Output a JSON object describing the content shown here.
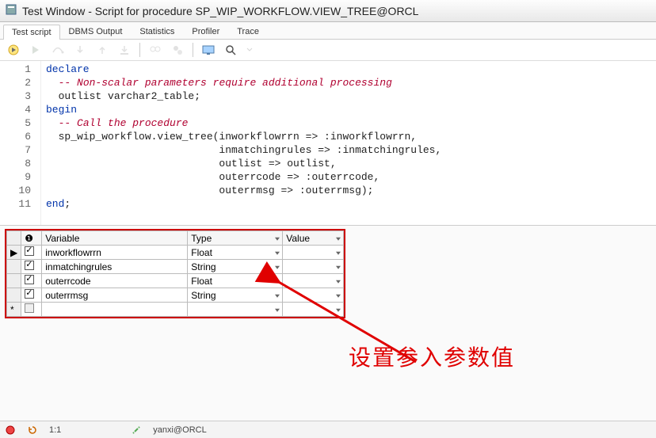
{
  "window": {
    "title": "Test Window - Script for procedure SP_WIP_WORKFLOW.VIEW_TREE@ORCL"
  },
  "tabs": [
    {
      "label": "Test script",
      "active": true
    },
    {
      "label": "DBMS Output"
    },
    {
      "label": "Statistics"
    },
    {
      "label": "Profiler"
    },
    {
      "label": "Trace"
    }
  ],
  "code": {
    "lines": [
      {
        "n": "1",
        "html": "<span class='kw'>declare</span>"
      },
      {
        "n": "2",
        "html": "  <span class='cmt'>-- Non-scalar parameters require additional processing</span>"
      },
      {
        "n": "3",
        "html": "  outlist varchar2_table;"
      },
      {
        "n": "4",
        "html": "<span class='kw'>begin</span>"
      },
      {
        "n": "5",
        "html": "  <span class='cmt'>-- Call the procedure</span>"
      },
      {
        "n": "6",
        "html": "  sp_wip_workflow.view_tree(inworkflowrrn =&gt; :inworkflowrrn,"
      },
      {
        "n": "7",
        "html": "                            inmatchingrules =&gt; :inmatchingrules,"
      },
      {
        "n": "8",
        "html": "                            outlist =&gt; outlist,"
      },
      {
        "n": "9",
        "html": "                            outerrcode =&gt; :outerrcode,"
      },
      {
        "n": "10",
        "html": "                            outerrmsg =&gt; :outerrmsg);"
      },
      {
        "n": "11",
        "html": "<span class='kw'>end</span>;"
      }
    ]
  },
  "vars": {
    "headers": {
      "warn": "❶",
      "variable": "Variable",
      "type": "Type",
      "value": "Value"
    },
    "rows": [
      {
        "marker": "▶",
        "checked": true,
        "variable": "inworkflowrrn",
        "type": "Float",
        "value": ""
      },
      {
        "marker": "",
        "checked": true,
        "variable": "inmatchingrules",
        "type": "String",
        "value": ""
      },
      {
        "marker": "",
        "checked": true,
        "variable": "outerrcode",
        "type": "Float",
        "value": ""
      },
      {
        "marker": "",
        "checked": true,
        "variable": "outerrmsg",
        "type": "String",
        "value": ""
      },
      {
        "marker": "*",
        "checked": false,
        "variable": "",
        "type": "",
        "value": ""
      }
    ]
  },
  "annotation": "设置参入参数值",
  "status": {
    "pos": "1:1",
    "conn": "yanxi@ORCL"
  }
}
